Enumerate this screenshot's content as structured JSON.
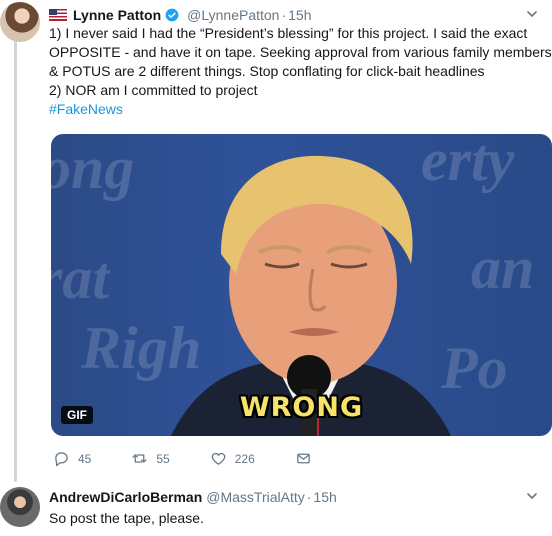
{
  "tweet1": {
    "name": "Lynne Patton",
    "handle": "@LynnePatton",
    "time": "15h",
    "text_lines": [
      "1) I never said I had the “President’s blessing” for this project.  I said the exact",
      "OPPOSITE - and have it on tape.  Seeking approval from various family members",
      "& POTUS are 2 different things.  Stop conflating for click-bait headlines",
      "2) NOR am I committed to project"
    ],
    "hashtag": "#FakeNews",
    "media": {
      "badge": "GIF",
      "caption": "WRONG"
    },
    "actions": {
      "replies": "45",
      "retweets": "55",
      "likes": "226"
    }
  },
  "tweet2": {
    "name": "AndrewDiCarloBerman",
    "handle": "@MassTrialAtty",
    "time": "15h",
    "text": "So post the tape, please."
  },
  "colors": {
    "link": "#1b95e0",
    "secondary": "#657786",
    "verified": "#1da1f2"
  },
  "icons": [
    "us-flag-icon",
    "verified-badge-icon",
    "chevron-down-icon",
    "reply-icon",
    "retweet-icon",
    "like-icon",
    "dm-icon"
  ]
}
